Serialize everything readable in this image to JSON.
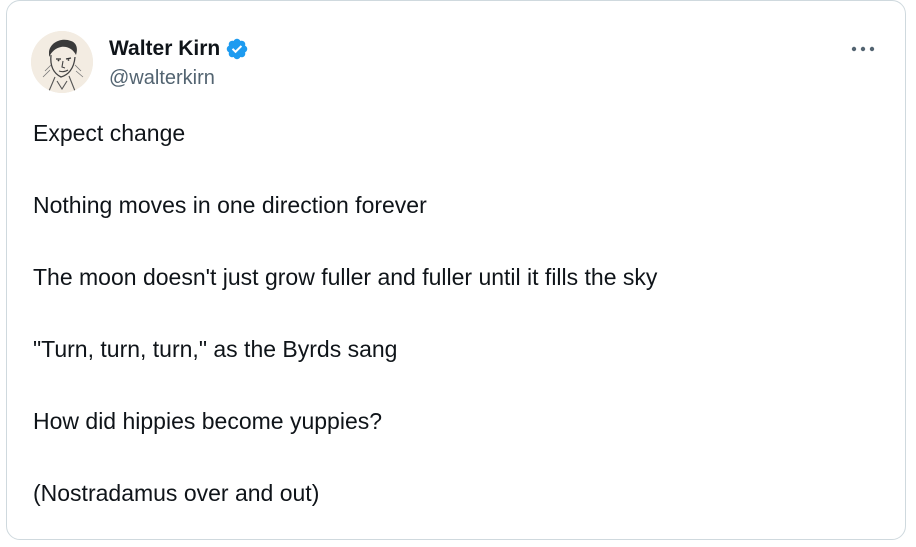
{
  "author": {
    "name": "Walter Kirn",
    "handle": "@walterkirn",
    "verified": true,
    "avatar_icon": "portrait-sketch-icon"
  },
  "menu": {
    "icon": "more-options-icon"
  },
  "tweet": {
    "lines": [
      "Expect change",
      "Nothing moves in one direction forever",
      "The moon doesn't just grow fuller and fuller until it fills the sky",
      "\"Turn, turn, turn,\" as the Byrds sang",
      "How did hippies become yuppies?",
      "(Nostradamus over and out)"
    ]
  },
  "colors": {
    "text": "#0f1419",
    "secondary_text": "#536471",
    "verified_badge": "#1d9bf0",
    "border": "#cfd9de"
  }
}
